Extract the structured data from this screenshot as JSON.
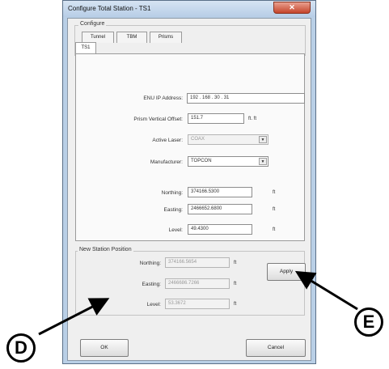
{
  "window": {
    "title": "Configure Total Station - TS1",
    "close_glyph": "✕"
  },
  "configure": {
    "group_label": "Configure",
    "tabs": [
      "Tunnel",
      "TBM",
      "Prisms"
    ],
    "active_tab": "TS1"
  },
  "fields": {
    "ip_label": "ENU IP Address:",
    "ip_value": "192 . 168 . 30 . 31",
    "prism_offset_label": "Prism Vertical Offset:",
    "prism_offset_value": "151.7",
    "prism_offset_unit": "ft. ft",
    "active_laser_label": "Active Laser:",
    "active_laser_value": "COAX",
    "manufacturer_label": "Manufacturer:",
    "manufacturer_value": "TOPCON",
    "northing_label": "Northing:",
    "northing_value": "374166.5300",
    "northing_unit": "ft",
    "easting_label": "Easting:",
    "easting_value": "2466652.6800",
    "easting_unit": "ft",
    "level_label": "Level:",
    "level_value": "49.4300",
    "level_unit": "ft"
  },
  "new_station": {
    "group_label": "New Station Position",
    "northing_label": "Northing:",
    "northing_value": "374166.5654",
    "northing_unit": "ft",
    "easting_label": "Easting:",
    "easting_value": "2466686.7266",
    "easting_unit": "ft",
    "level_label": "Level:",
    "level_value": "53.3672",
    "level_unit": "ft",
    "apply_label": "Apply"
  },
  "buttons": {
    "ok_label": "OK",
    "cancel_label": "Cancel"
  },
  "callouts": {
    "d_label": "D",
    "e_label": "E"
  },
  "colors": {
    "title_bar": "#b7cde6",
    "close_button": "#c5442a",
    "dialog_background": "#efefef"
  }
}
